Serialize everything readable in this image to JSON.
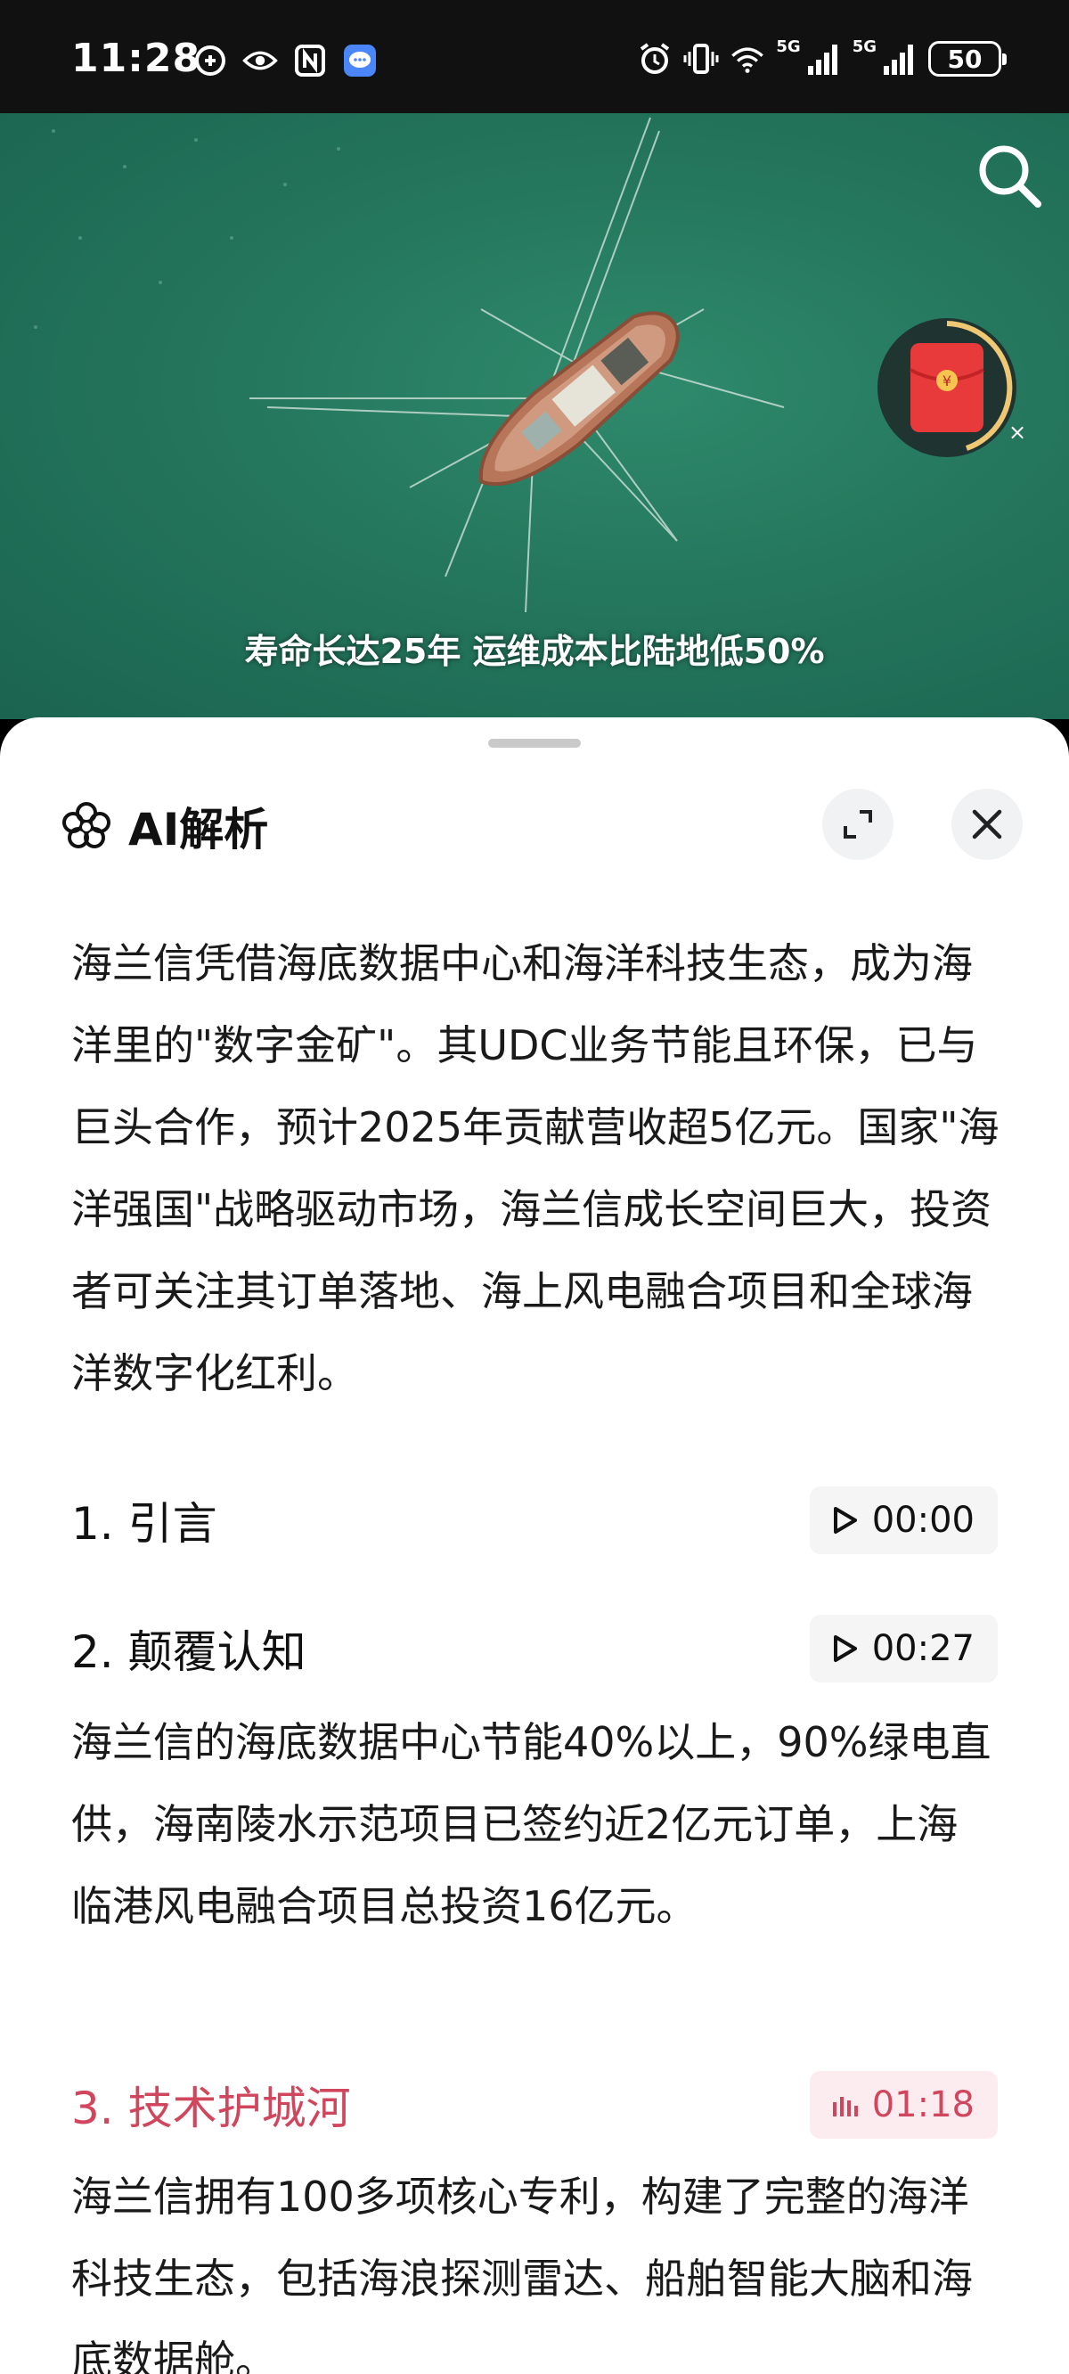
{
  "status_bar": {
    "time": "11:28",
    "battery": "50",
    "net1": "5G",
    "net2": "5G"
  },
  "video": {
    "caption": "寿命长达25年 运维成本比陆地低50%",
    "redpacket_symbol": "¥",
    "redpacket_close": "×"
  },
  "panel": {
    "title": "AI解析",
    "summary": "海兰信凭借海底数据中心和海洋科技生态，成为海洋里的\"数字金矿\"。其UDC业务节能且环保，已与巨头合作，预计2025年贡献营收超5亿元。国家\"海洋强国\"战略驱动市场，海兰信成长空间巨大，投资者可关注其订单落地、海上风电融合项目和全球海洋数字化红利。",
    "sections": [
      {
        "title": "1. 引言",
        "time": "00:00",
        "body": ""
      },
      {
        "title": "2. 颠覆认知",
        "time": "00:27",
        "body": "海兰信的海底数据中心节能40%以上，90%绿电直供，海南陵水示范项目已签约近2亿元订单，上海临港风电融合项目总投资16亿元。"
      },
      {
        "title": "3. 技术护城河",
        "time": "01:18",
        "body": "海兰信拥有100多项核心专利，构建了完整的海洋科技生态，包括海浪探测雷达、船舶智能大脑和海底数据舱。"
      }
    ]
  },
  "colors": {
    "accent": "#d0465d",
    "sea": "#24765c"
  }
}
